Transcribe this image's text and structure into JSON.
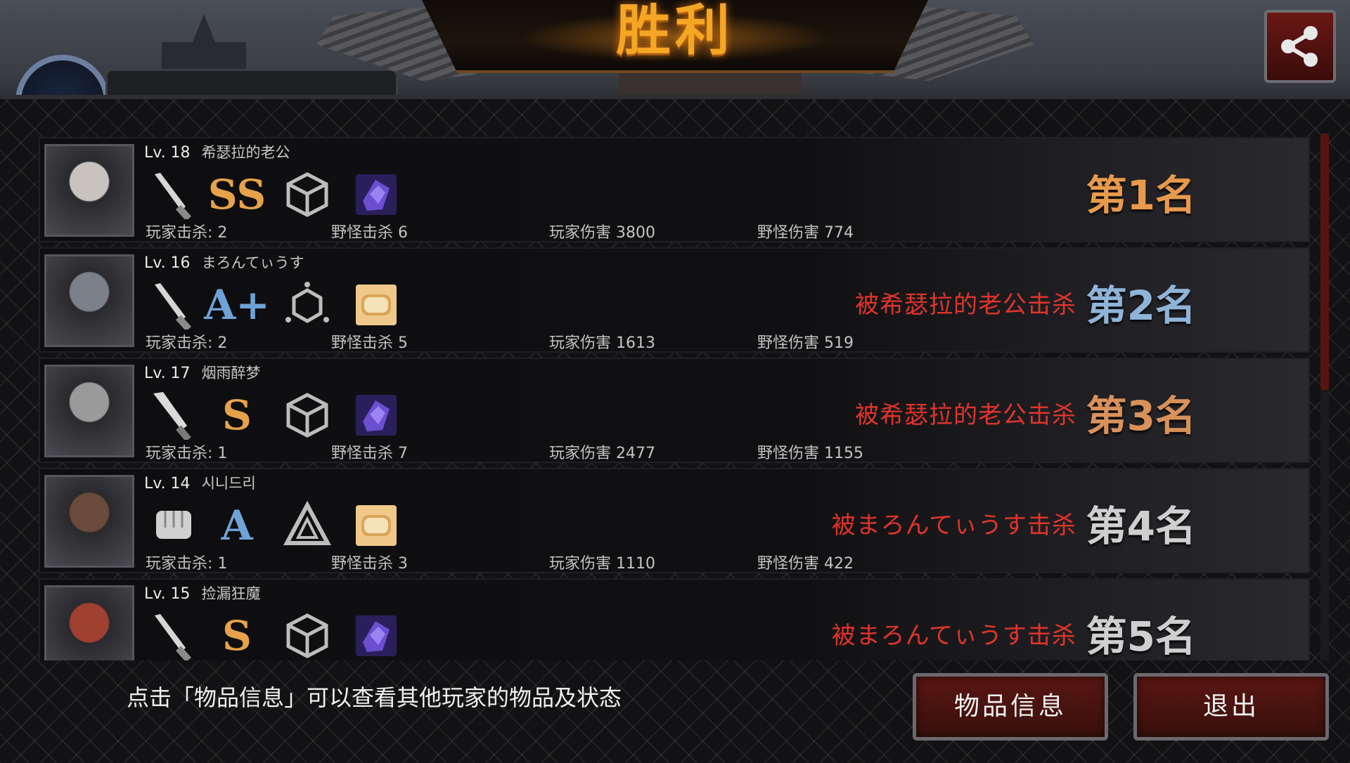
{
  "header": {
    "title": "胜利",
    "share_icon": "share-icon"
  },
  "players": [
    {
      "level": "Lv. 18",
      "name": "希瑟拉的老公",
      "weapon_icon": "knife-icon",
      "grade": "SS",
      "grade_color": "#e6a24a",
      "armor_icon": "cube-icon",
      "item_icon": "purple-gem-icon",
      "stats": {
        "player_kills": "玩家击杀: 2",
        "monster_kills": "野怪击杀 6",
        "player_damage": "玩家伤害 3800",
        "monster_damage": "野怪伤害 774"
      },
      "killed_by": "",
      "rank": "第1名",
      "rank_color": "#e89a4c"
    },
    {
      "level": "Lv. 16",
      "name": "まろんてぃうす",
      "weapon_icon": "knife-icon",
      "grade": "A+",
      "grade_color": "#6fa3d8",
      "armor_icon": "hex-network-icon",
      "item_icon": "bread-icon",
      "stats": {
        "player_kills": "玩家击杀: 2",
        "monster_kills": "野怪击杀 5",
        "player_damage": "玩家伤害 1613",
        "monster_damage": "野怪伤害 519"
      },
      "killed_by": "被希瑟拉的老公击杀",
      "rank": "第2名",
      "rank_color": "#8fb4d8"
    },
    {
      "level": "Lv. 17",
      "name": "烟雨醉梦",
      "weapon_icon": "machete-icon",
      "grade": "S",
      "grade_color": "#e6a24a",
      "armor_icon": "cube-icon",
      "item_icon": "purple-gem-icon",
      "stats": {
        "player_kills": "玩家击杀: 1",
        "monster_kills": "野怪击杀 7",
        "player_damage": "玩家伤害 2477",
        "monster_damage": "野怪伤害 1155"
      },
      "killed_by": "被希瑟拉的老公击杀",
      "rank": "第3名",
      "rank_color": "#d9915a"
    },
    {
      "level": "Lv. 14",
      "name": "시니드리",
      "weapon_icon": "fist-icon",
      "grade": "A",
      "grade_color": "#6fa3d8",
      "armor_icon": "triangle-icon",
      "item_icon": "bread-icon",
      "stats": {
        "player_kills": "玩家击杀: 1",
        "monster_kills": "野怪击杀 3",
        "player_damage": "玩家伤害 1110",
        "monster_damage": "野怪伤害 422"
      },
      "killed_by": "被まろんてぃうす击杀",
      "rank": "第4名",
      "rank_color": "#cfcfcf"
    },
    {
      "level": "Lv. 15",
      "name": "捡漏狂魔",
      "weapon_icon": "knife-icon",
      "grade": "S",
      "grade_color": "#e6a24a",
      "armor_icon": "cube-icon",
      "item_icon": "purple-gem-icon",
      "stats": {
        "player_kills": "",
        "monster_kills": "",
        "player_damage": "",
        "monster_damage": ""
      },
      "killed_by": "被まろんてぃうす击杀",
      "rank": "第5名",
      "rank_color": "#cfcfcf"
    }
  ],
  "footer": {
    "hint": "点击「物品信息」可以查看其他玩家的物品及状态",
    "item_info_button": "物品信息",
    "exit_button": "退出"
  }
}
